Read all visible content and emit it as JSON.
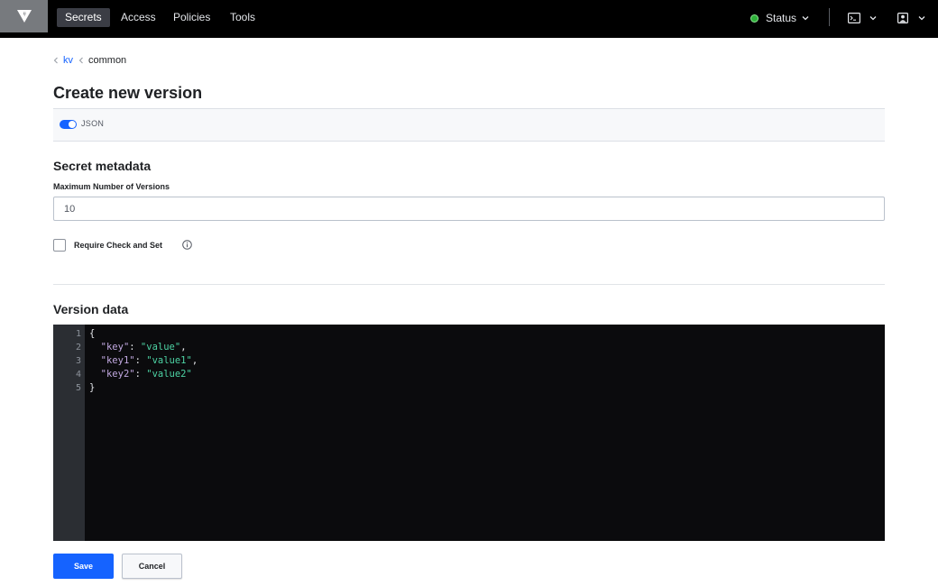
{
  "topnav": {
    "items": [
      {
        "label": "Secrets",
        "active": true
      },
      {
        "label": "Access",
        "active": false
      },
      {
        "label": "Policies",
        "active": false
      },
      {
        "label": "Tools",
        "active": false
      }
    ],
    "status_label": "Status",
    "status_color": "#2eb039",
    "icons": [
      "vault-logo-icon",
      "terminal-icon",
      "user-icon",
      "chevron-down-icon"
    ]
  },
  "breadcrumb": {
    "items": [
      "kv",
      "common"
    ]
  },
  "page": {
    "title": "Create new version",
    "json_toggle_label": "JSON",
    "json_toggle_on": true
  },
  "metadata": {
    "section_title": "Secret metadata",
    "max_versions_label": "Maximum Number of Versions",
    "max_versions_value": "10",
    "cas_label": "Require Check and Set",
    "cas_checked": false
  },
  "version_data": {
    "section_title": "Version data",
    "line_numbers": [
      "1",
      "2",
      "3",
      "4",
      "5"
    ],
    "lines": [
      {
        "key": "",
        "value": "",
        "text": "{"
      },
      {
        "key": "\"key\"",
        "value": "\"value\"",
        "suffix": ","
      },
      {
        "key": "\"key1\"",
        "value": "\"value1\"",
        "suffix": ","
      },
      {
        "key": "\"key2\"",
        "value": "\"value2\"",
        "suffix": ""
      },
      {
        "key": "",
        "value": "",
        "text": "}"
      }
    ]
  },
  "actions": {
    "save_label": "Save",
    "cancel_label": "Cancel"
  },
  "colors": {
    "accent": "#1563ff",
    "nav_bg": "#000000",
    "editor_bg": "#0b0b0d",
    "json_key": "#c1a8e0",
    "json_string": "#4dd3a4"
  }
}
